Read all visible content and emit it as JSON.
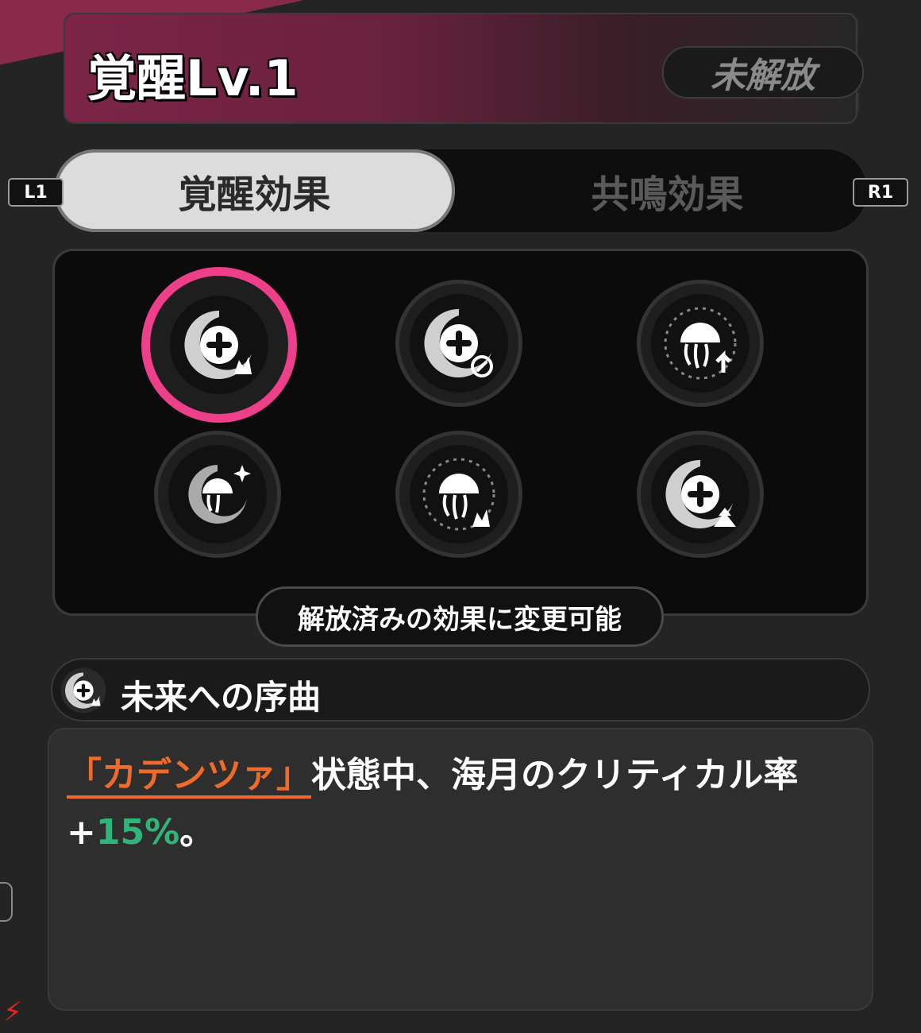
{
  "header": {
    "title": "覚醒Lv.1",
    "status": "未解放"
  },
  "keys": {
    "left": "L1",
    "right": "R1"
  },
  "tabs": [
    {
      "label": "覚醒効果",
      "active": true
    },
    {
      "label": "共鳴効果",
      "active": false
    }
  ],
  "skills": [
    {
      "icon": "swirl-plus-flame-icon",
      "selected": true
    },
    {
      "icon": "swirl-plus-target-icon",
      "selected": false
    },
    {
      "icon": "jellyfish-up-arrow-icon",
      "selected": false
    },
    {
      "icon": "jellyfish-swirl-star-icon",
      "selected": false
    },
    {
      "icon": "jellyfish-flame-icon",
      "selected": false
    },
    {
      "icon": "swirl-plus-up-arrow-icon",
      "selected": false
    }
  ],
  "hint": "解放済みの効果に変更可能",
  "effect": {
    "name": "未来への序曲",
    "keyword": "「カデンツァ」",
    "text_before": "状態中、海月のクリティカル率+",
    "value": "15%",
    "text_after": "。"
  },
  "colors": {
    "selected_ring": "#ee3f8a",
    "keyword": "#f06a2a",
    "value": "#2fb57a"
  }
}
